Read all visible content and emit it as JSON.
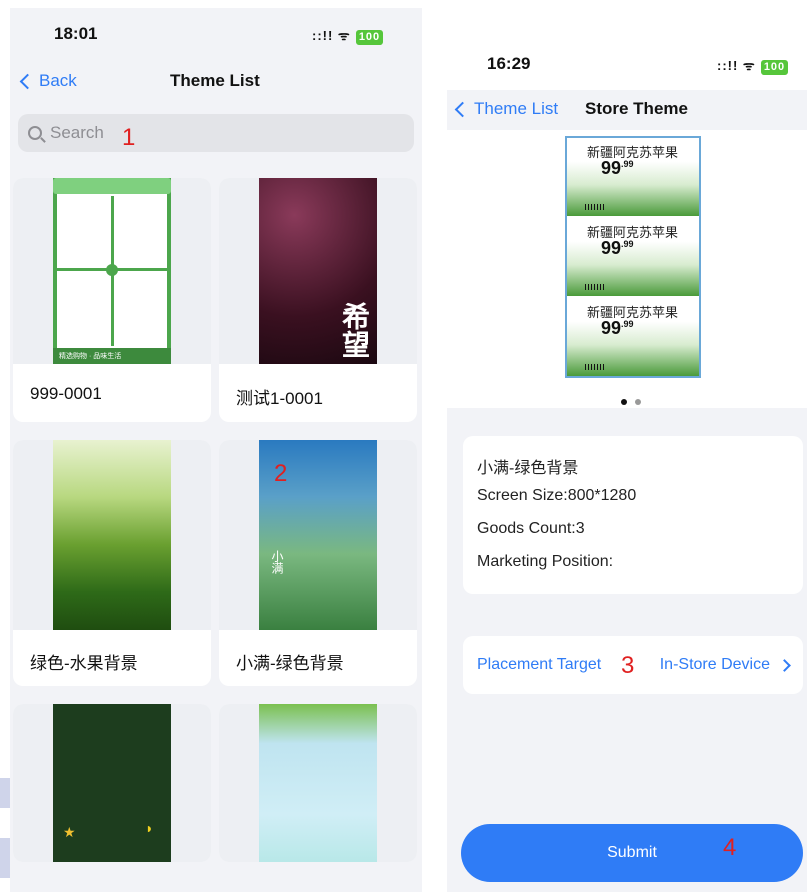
{
  "left_screen": {
    "status": {
      "time": "18:01",
      "signal": "::!! ᯤ",
      "battery": "100"
    },
    "nav": {
      "back_label": "Back",
      "title": "Theme List"
    },
    "search": {
      "placeholder": "Search"
    },
    "annotation": "1",
    "cards": [
      {
        "label": "999-0001",
        "thumb_text": "精选购物 · 品味生活"
      },
      {
        "label": "测试1-0001",
        "thumb_text": "希望"
      },
      {
        "label": "绿色-水果背景",
        "thumb_text": ""
      },
      {
        "label": "小满-绿色背景",
        "thumb_text": "小满",
        "annotation": "2"
      },
      {
        "label": "",
        "thumb_text": ""
      },
      {
        "label": "",
        "thumb_text": ""
      }
    ]
  },
  "right_screen": {
    "status": {
      "time": "16:29",
      "signal": "::!! ᯤ",
      "battery": "100"
    },
    "nav": {
      "back_label": "Theme List",
      "title": "Store Theme"
    },
    "preview": {
      "products": [
        {
          "name": "新疆阿克苏苹果",
          "price_main": "99",
          "price_cents": ".99"
        },
        {
          "name": "新疆阿克苏苹果",
          "price_main": "99",
          "price_cents": ".99"
        },
        {
          "name": "新疆阿克苏苹果",
          "price_main": "99",
          "price_cents": ".99"
        }
      ],
      "page_count": 2,
      "current_page": 1
    },
    "info": {
      "name": "小满-绿色背景",
      "screen_size": "Screen Size:800*1280",
      "goods_count": "Goods Count:3",
      "marketing_position": "Marketing Position:"
    },
    "placement": {
      "label": "Placement Target",
      "value": "In-Store Device",
      "annotation": "3"
    },
    "submit": {
      "label": "Submit",
      "annotation": "4"
    }
  },
  "colors": {
    "accent": "#2f7cf6",
    "annotation": "#e02020",
    "background": "#f2f3f7"
  }
}
